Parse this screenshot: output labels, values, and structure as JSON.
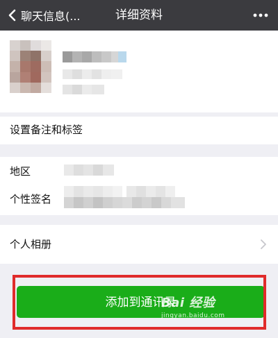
{
  "nav": {
    "back_label": "聊天信息(...",
    "title": "详细资料"
  },
  "cells": {
    "remark": "设置备注和标签",
    "region": "地区",
    "signature": "个性签名",
    "album": "个人相册"
  },
  "add_button": {
    "label": "添加到通讯录"
  },
  "watermark": {
    "text": "Bai 经验",
    "url": "jingyan.baidu.com"
  },
  "colors": {
    "nav_bg": "#3b3b3f",
    "button_green": "#1aad19",
    "highlight_red": "#e02b2b",
    "page_bg": "#efeff4"
  },
  "icons": {
    "back": "chevron-left-icon",
    "more": "more-dots-icon",
    "disclosure": "chevron-right-icon"
  }
}
